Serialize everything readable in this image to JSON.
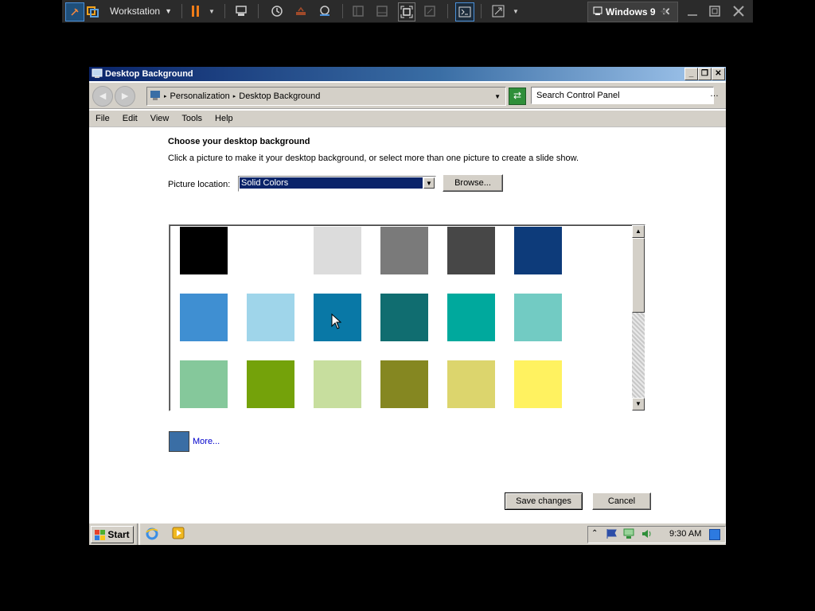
{
  "vm_toolbar": {
    "title": "Workstation",
    "tab_label": "Windows 9"
  },
  "window": {
    "title": "Desktop Background",
    "addressbar": {
      "breadcrumb": [
        "Personalization",
        "Desktop Background"
      ],
      "search_placeholder": "Search Control Panel"
    },
    "menu": [
      "File",
      "Edit",
      "View",
      "Tools",
      "Help"
    ]
  },
  "content": {
    "heading": "Choose your desktop background",
    "instructions": "Click a picture to make it your desktop background, or select more than one picture to create a slide show.",
    "picture_location_label": "Picture location:",
    "picture_location_value": "Solid Colors",
    "browse_label": "Browse...",
    "more_label": "More...",
    "more_swatch_color": "#3a6ea5",
    "save_label": "Save changes",
    "cancel_label": "Cancel"
  },
  "swatches": [
    [
      "#000000",
      "#ffffff",
      "#dcdcdc",
      "#7a7a7a",
      "#474747",
      "#0d3b7a"
    ],
    [
      "#3f8fd2",
      "#9fd5ea",
      "#0978a6",
      "#106d70",
      "#00a99d",
      "#72cbc3"
    ],
    [
      "#85c89b",
      "#74a20a",
      "#c7de9e",
      "#858721",
      "#dcd56d",
      "#fff260"
    ]
  ],
  "taskbar": {
    "start_label": "Start",
    "clock": "9:30 AM"
  }
}
